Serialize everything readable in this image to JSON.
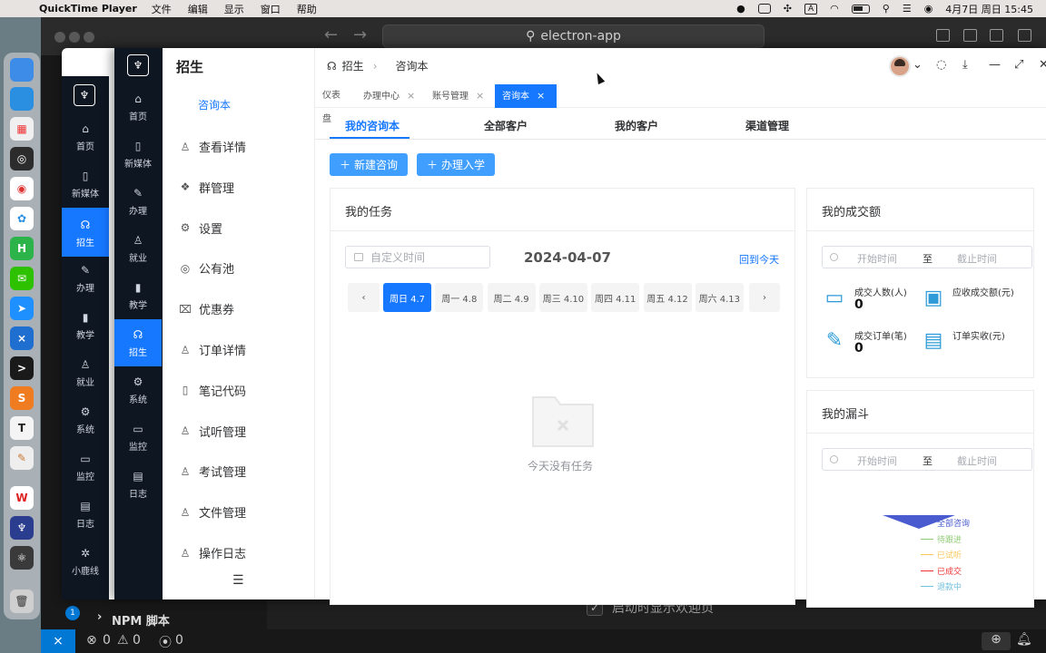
{
  "menubar": {
    "app_name": "QuickTime Player",
    "items": [
      "文件",
      "编辑",
      "显示",
      "窗口",
      "帮助"
    ],
    "clock": "4月7日 周日 15:45",
    "input_badge": "A"
  },
  "vscode": {
    "search": "electron-app",
    "sidebar_section": "NPM 脚本",
    "welcome_checkbox": "启动时显示欢迎页",
    "status": {
      "errors": "0",
      "warnings": "0",
      "ports": "0",
      "badge": "1"
    }
  },
  "outer_rail": {
    "items": [
      {
        "label": "首页",
        "icon": "home-icon"
      },
      {
        "label": "新媒体",
        "icon": "tablet-icon"
      },
      {
        "label": "招生",
        "icon": "headset-icon"
      },
      {
        "label": "办理",
        "icon": "pen-icon"
      },
      {
        "label": "教学",
        "icon": "mic-icon"
      },
      {
        "label": "就业",
        "icon": "user-icon"
      },
      {
        "label": "系统",
        "icon": "gear-icon"
      },
      {
        "label": "监控",
        "icon": "monitor-icon"
      },
      {
        "label": "日志",
        "icon": "log-icon"
      },
      {
        "label": "小鹿线",
        "icon": "bug-icon"
      }
    ]
  },
  "rail": {
    "items": [
      {
        "label": "首页",
        "icon": "home-icon"
      },
      {
        "label": "新媒体",
        "icon": "tablet-icon"
      },
      {
        "label": "办理",
        "icon": "pen-icon"
      },
      {
        "label": "就业",
        "icon": "user-icon"
      },
      {
        "label": "教学",
        "icon": "mic-icon"
      },
      {
        "label": "招生",
        "icon": "headset-icon"
      },
      {
        "label": "系统",
        "icon": "gear-icon"
      },
      {
        "label": "监控",
        "icon": "monitor-icon"
      },
      {
        "label": "日志",
        "icon": "log-icon"
      }
    ]
  },
  "submenu": {
    "title": "招生",
    "active": "咨询本",
    "items": [
      {
        "label": "查看详情",
        "icon": "user-icon"
      },
      {
        "label": "群管理",
        "icon": "group-icon"
      },
      {
        "label": "设置",
        "icon": "gear-icon"
      },
      {
        "label": "公有池",
        "icon": "pool-icon"
      },
      {
        "label": "优惠券",
        "icon": "coupon-icon"
      },
      {
        "label": "订单详情",
        "icon": "user-icon"
      },
      {
        "label": "笔记代码",
        "icon": "notebook-icon"
      },
      {
        "label": "试听管理",
        "icon": "user-icon"
      },
      {
        "label": "考试管理",
        "icon": "user-icon"
      },
      {
        "label": "文件管理",
        "icon": "user-icon"
      },
      {
        "label": "操作日志",
        "icon": "user-icon"
      }
    ]
  },
  "breadcrumb": {
    "root": "招生",
    "current": "咨询本"
  },
  "page_tabs": [
    {
      "label": "仪表盘",
      "closable": false
    },
    {
      "label": "办理中心",
      "closable": true
    },
    {
      "label": "账号管理",
      "closable": true
    },
    {
      "label": "咨询本",
      "closable": true
    }
  ],
  "sub_tabs": [
    "我的咨询本",
    "全部客户",
    "我的客户",
    "渠道管理"
  ],
  "buttons": {
    "new_consult": "新建咨询",
    "enroll": "办理入学"
  },
  "tasks": {
    "title": "我的任务",
    "date_placeholder": "自定义时间",
    "date": "2024-04-07",
    "today_link": "回到今天",
    "days": [
      "周日 4.7",
      "周一 4.8",
      "周二 4.9",
      "周三 4.10",
      "周四 4.11",
      "周五 4.12",
      "周六 4.13"
    ],
    "active_day": 0,
    "empty": "今天没有任务"
  },
  "deals": {
    "title": "我的成交额",
    "range_start": "开始时间",
    "range_sep": "至",
    "range_end": "截止时间",
    "stats": [
      {
        "label": "成交人数(人)",
        "value": "0",
        "icon": "monitor-icon"
      },
      {
        "label": "应收成交额(元)",
        "value": "",
        "icon": "money-icon"
      },
      {
        "label": "成交订单(笔)",
        "value": "0",
        "icon": "pencil-icon"
      },
      {
        "label": "订单实收(元)",
        "value": "",
        "icon": "calendar-icon"
      }
    ]
  },
  "funnel": {
    "title": "我的漏斗",
    "range_start": "开始时间",
    "range_sep": "至",
    "range_end": "截止时间",
    "legend": [
      {
        "label": "全部咨询",
        "color": "#4a5bd0"
      },
      {
        "label": "待跟进",
        "color": "#91cc75"
      },
      {
        "label": "已试听",
        "color": "#fac858"
      },
      {
        "label": "已成交",
        "color": "#ee3333"
      },
      {
        "label": "退款中",
        "color": "#73c0de"
      }
    ]
  },
  "colors": {
    "accent": "#1677ff",
    "rail_bg": "#0e1621",
    "button": "#409eff"
  }
}
